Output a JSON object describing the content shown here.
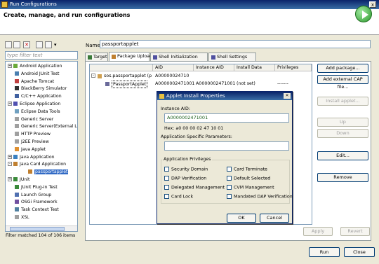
{
  "window": {
    "title": "Run Configurations",
    "close_label": "x"
  },
  "header": {
    "title": "Create, manage, and run configurations"
  },
  "toolbar": {
    "icons": [
      "new-icon",
      "duplicate-icon",
      "delete-icon",
      "collapse-icon",
      "filter-icon"
    ],
    "dropdown": "▾"
  },
  "filter": {
    "placeholder": "type filter text"
  },
  "tree": [
    {
      "label": "Android Application",
      "expander": "+",
      "indent": 0,
      "icon": "#6aaa3a"
    },
    {
      "label": "Android JUnit Test",
      "expander": "",
      "indent": 0,
      "icon": "#4a7fb0"
    },
    {
      "label": "Apache Tomcat",
      "expander": "",
      "indent": 0,
      "icon": "#c04040"
    },
    {
      "label": "BlackBerry Simulator",
      "expander": "",
      "indent": 0,
      "icon": "#303030"
    },
    {
      "label": "C/C++ Application",
      "expander": "",
      "indent": 0,
      "icon": "#4060a0"
    },
    {
      "label": "Eclipse Application",
      "expander": "+",
      "indent": 0,
      "icon": "#5050b0"
    },
    {
      "label": "Eclipse Data Tools",
      "expander": "",
      "indent": 0,
      "icon": "#70a0c0"
    },
    {
      "label": "Generic Server",
      "expander": "",
      "indent": 0,
      "icon": "#a0a0a0"
    },
    {
      "label": "Generic Server(External Lau",
      "expander": "",
      "indent": 0,
      "icon": "#a0a0a0"
    },
    {
      "label": "HTTP Preview",
      "expander": "",
      "indent": 0,
      "icon": "#a0a0a0"
    },
    {
      "label": "J2EE Preview",
      "expander": "",
      "indent": 0,
      "icon": "#a0a0a0"
    },
    {
      "label": "Java Applet",
      "expander": "",
      "indent": 0,
      "icon": "#e09030"
    },
    {
      "label": "Java Application",
      "expander": "+",
      "indent": 0,
      "icon": "#3a80c0"
    },
    {
      "label": "Java Card Application",
      "expander": "-",
      "indent": 0,
      "icon": "#c08030"
    },
    {
      "label": "passportapplet",
      "expander": "",
      "indent": 1,
      "icon": "#c08030",
      "selected": true
    },
    {
      "label": "JUnit",
      "expander": "+",
      "indent": 0,
      "icon": "#3a8a3a"
    },
    {
      "label": "JUnit Plug-in Test",
      "expander": "",
      "indent": 0,
      "icon": "#3a8a3a"
    },
    {
      "label": "Launch Group",
      "expander": "",
      "indent": 0,
      "icon": "#5070b0"
    },
    {
      "label": "OSGi Framework",
      "expander": "",
      "indent": 0,
      "icon": "#7050a0"
    },
    {
      "label": "Task Context Test",
      "expander": "",
      "indent": 0,
      "icon": "#5080a0"
    },
    {
      "label": "XSL",
      "expander": "",
      "indent": 0,
      "icon": "#a0a0a0"
    }
  ],
  "status": "Filter matched 104 of 106 items",
  "name": {
    "label": "Name:",
    "value": "passportapplet"
  },
  "tabs": [
    {
      "label": "Target",
      "icon": "#3a7a3a"
    },
    {
      "label": "Package Upload",
      "icon": "#c08030"
    },
    {
      "label": "Shell Initialization",
      "icon": "#5050a0"
    },
    {
      "label": "Shell Settings",
      "icon": "#5050a0"
    }
  ],
  "table": {
    "headers": [
      "",
      "AID",
      "Instance AID",
      "Install Data",
      "Privileges"
    ],
    "rows": [
      {
        "name": "sos.passportapplet (p",
        "aid": "A00000024710",
        "instance": "",
        "data": "",
        "priv": "",
        "expander": "-"
      },
      {
        "name": "PassportApplet",
        "aid": "A0000002471001",
        "instance": "A0000002471001",
        "data": "(not set)",
        "priv": "-------",
        "expander": ""
      }
    ]
  },
  "side_buttons": {
    "add_package": "Add package...",
    "add_cap": "Add external CAP file...",
    "install": "Install applet...",
    "up": "Up",
    "down": "Down",
    "edit": "Edit...",
    "remove": "Remove"
  },
  "bottom": {
    "apply": "Apply",
    "revert": "Revert",
    "run": "Run",
    "close": "Close"
  },
  "dialog": {
    "title": "Applet Install Properties",
    "instance_label": "Instance AID:",
    "instance_value": "A0000002471001",
    "hex_label": "Hex: a0 00 00 02 47 10 01",
    "params_label": "Application Specific Parameters:",
    "params_value": "",
    "group_label": "Application Privileges",
    "privileges_left": [
      "Security Domain",
      "DAP Verification",
      "Delegated Management",
      "Card Lock"
    ],
    "privileges_right": [
      "Card Terminate",
      "Default Selected",
      "CVM Management",
      "Mandated DAP Verification"
    ],
    "ok": "OK",
    "cancel": "Cancel"
  }
}
